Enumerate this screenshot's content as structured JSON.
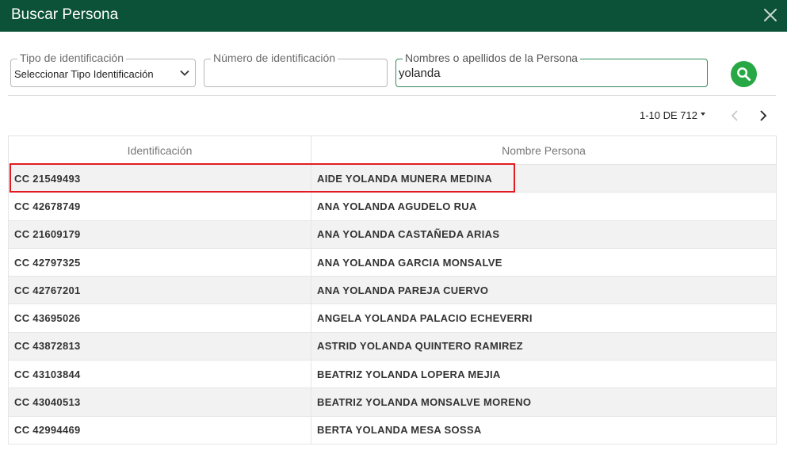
{
  "dialog": {
    "title": "Buscar Persona",
    "close_icon": "close-icon",
    "header_color": "#0c5239"
  },
  "filters": {
    "tipo": {
      "legend": "Tipo de identificación",
      "value": "Seleccionar Tipo Identificación"
    },
    "numero": {
      "legend": "Número de identificación",
      "value": ""
    },
    "nombres": {
      "legend": "Nombres o apellidos de la Persona",
      "value": "yolanda"
    },
    "search_icon": "search-icon",
    "search_color": "#27a844"
  },
  "pagination": {
    "label": "1-10 DE 712",
    "prev_icon": "chevron-left-icon",
    "next_icon": "chevron-right-icon"
  },
  "table": {
    "headers": [
      "Identificación",
      "Nombre Persona"
    ],
    "rows": [
      {
        "id": "CC 21549493",
        "name": "AIDE YOLANDA MUNERA MEDINA"
      },
      {
        "id": "CC 42678749",
        "name": "ANA YOLANDA AGUDELO RUA"
      },
      {
        "id": "CC 21609179",
        "name": "ANA YOLANDA CASTAÑEDA ARIAS"
      },
      {
        "id": "CC 42797325",
        "name": "ANA YOLANDA GARCIA MONSALVE"
      },
      {
        "id": "CC 42767201",
        "name": "ANA YOLANDA PAREJA CUERVO"
      },
      {
        "id": "CC 43695026",
        "name": "ANGELA YOLANDA PALACIO ECHEVERRI"
      },
      {
        "id": "CC 43872813",
        "name": "ASTRID YOLANDA QUINTERO RAMIREZ"
      },
      {
        "id": "CC 43103844",
        "name": "BEATRIZ YOLANDA LOPERA MEJIA"
      },
      {
        "id": "CC 43040513",
        "name": "BEATRIZ YOLANDA MONSALVE MORENO"
      },
      {
        "id": "CC 42994469",
        "name": "BERTA YOLANDA MESA SOSSA"
      }
    ],
    "highlight_color": "#e11b22"
  }
}
